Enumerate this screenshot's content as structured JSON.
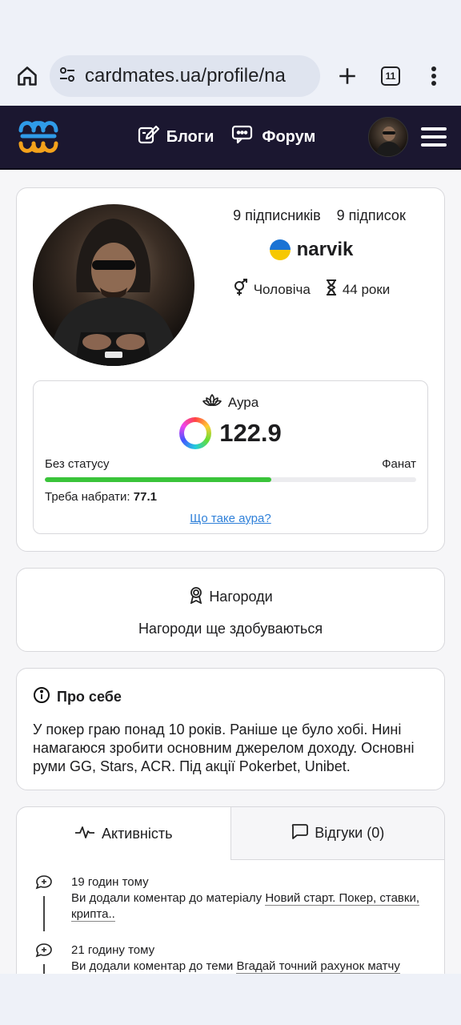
{
  "browser": {
    "url": "cardmates.ua/profile/na",
    "tab_count": "11"
  },
  "header": {
    "nav": [
      {
        "label": "Блоги",
        "icon": "edit-icon"
      },
      {
        "label": "Форум",
        "icon": "chat-icon"
      }
    ]
  },
  "profile": {
    "followers": "9 підписників",
    "following": "9 підписок",
    "username": "narvik",
    "gender": "Чоловіча",
    "age": "44 роки"
  },
  "aura": {
    "title": "Аура",
    "value": "122.9",
    "status_from": "Без статусу",
    "status_to": "Фанат",
    "progress_percent": 61,
    "need_label": "Треба набрати:",
    "need_value": "77.1",
    "link": "Що таке аура?"
  },
  "awards": {
    "title": "Нагороди",
    "text": "Нагороди ще здобуваються"
  },
  "about": {
    "title": "Про себе",
    "text": "У покер граю понад 10 років. Раніше це було хобі. Нині намагаюся зробити основним джерелом доходу. Основні руми GG, Stars, ACR. Під акції Pokerbet, Unibet."
  },
  "activity": {
    "tabs": [
      {
        "label": "Активність",
        "active": true
      },
      {
        "label": "Відгуки (0)",
        "active": false
      }
    ],
    "entries": [
      {
        "time": "19 годин тому",
        "prefix": "Ви додали коментар до матеріалу ",
        "link": "Новий старт. Покер, ставки, крипта.."
      },
      {
        "time": "21 годину тому",
        "prefix": "Ви додали коментар до теми ",
        "link": "Вгадай точний рахунок матчу"
      }
    ]
  },
  "colors": {
    "header_bg": "#1b1730",
    "progress": "#3ac43a",
    "link": "#2f80d9"
  }
}
